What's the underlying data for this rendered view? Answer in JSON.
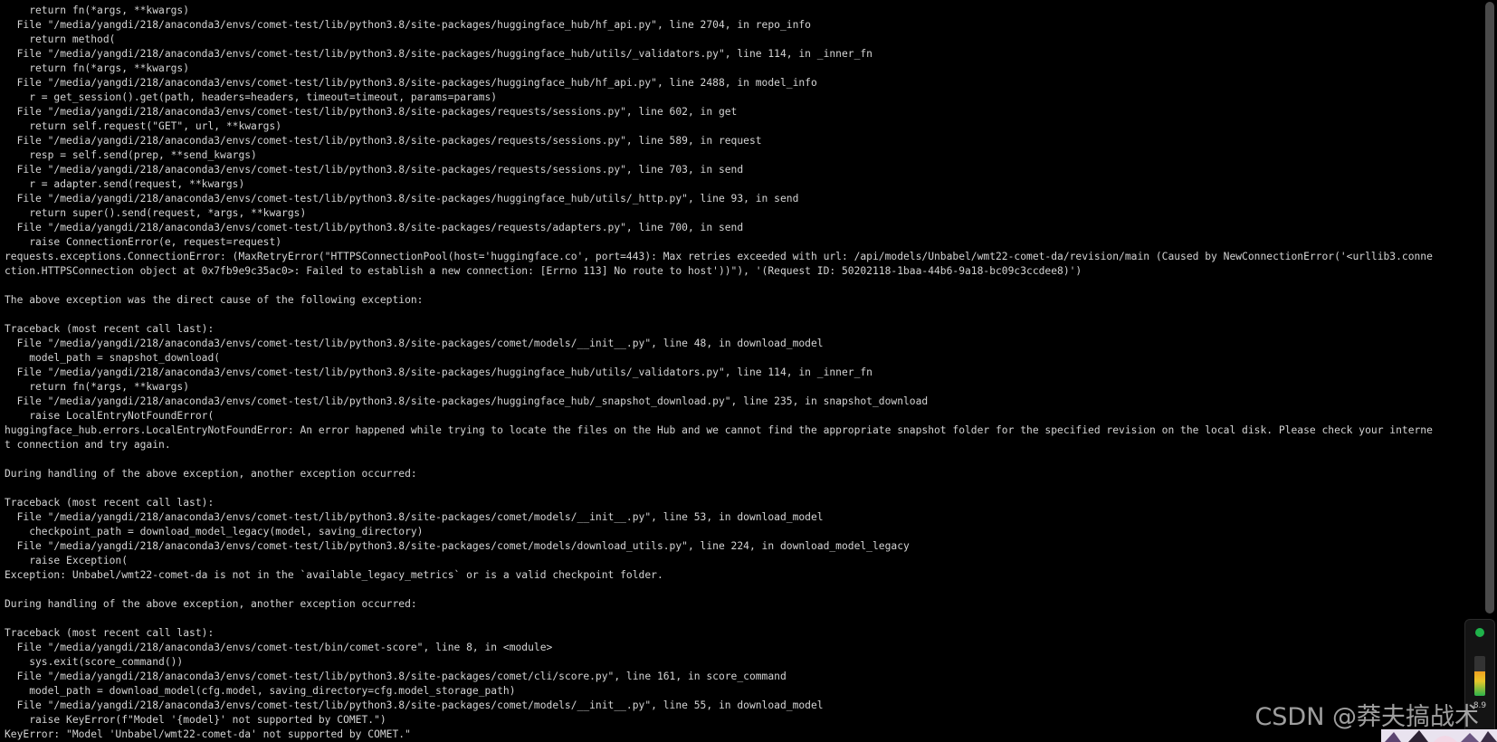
{
  "terminal": {
    "lines": [
      "    return fn(*args, **kwargs)",
      "  File \"/media/yangdi/218/anaconda3/envs/comet-test/lib/python3.8/site-packages/huggingface_hub/hf_api.py\", line 2704, in repo_info",
      "    return method(",
      "  File \"/media/yangdi/218/anaconda3/envs/comet-test/lib/python3.8/site-packages/huggingface_hub/utils/_validators.py\", line 114, in _inner_fn",
      "    return fn(*args, **kwargs)",
      "  File \"/media/yangdi/218/anaconda3/envs/comet-test/lib/python3.8/site-packages/huggingface_hub/hf_api.py\", line 2488, in model_info",
      "    r = get_session().get(path, headers=headers, timeout=timeout, params=params)",
      "  File \"/media/yangdi/218/anaconda3/envs/comet-test/lib/python3.8/site-packages/requests/sessions.py\", line 602, in get",
      "    return self.request(\"GET\", url, **kwargs)",
      "  File \"/media/yangdi/218/anaconda3/envs/comet-test/lib/python3.8/site-packages/requests/sessions.py\", line 589, in request",
      "    resp = self.send(prep, **send_kwargs)",
      "  File \"/media/yangdi/218/anaconda3/envs/comet-test/lib/python3.8/site-packages/requests/sessions.py\", line 703, in send",
      "    r = adapter.send(request, **kwargs)",
      "  File \"/media/yangdi/218/anaconda3/envs/comet-test/lib/python3.8/site-packages/huggingface_hub/utils/_http.py\", line 93, in send",
      "    return super().send(request, *args, **kwargs)",
      "  File \"/media/yangdi/218/anaconda3/envs/comet-test/lib/python3.8/site-packages/requests/adapters.py\", line 700, in send",
      "    raise ConnectionError(e, request=request)",
      "requests.exceptions.ConnectionError: (MaxRetryError(\"HTTPSConnectionPool(host='huggingface.co', port=443): Max retries exceeded with url: /api/models/Unbabel/wmt22-comet-da/revision/main (Caused by NewConnectionError('<urllib3.conne",
      "ction.HTTPSConnection object at 0x7fb9e9c35ac0>: Failed to establish a new connection: [Errno 113] No route to host'))\"), '(Request ID: 50202118-1baa-44b6-9a18-bc09c3ccdee8)')",
      "",
      "The above exception was the direct cause of the following exception:",
      "",
      "Traceback (most recent call last):",
      "  File \"/media/yangdi/218/anaconda3/envs/comet-test/lib/python3.8/site-packages/comet/models/__init__.py\", line 48, in download_model",
      "    model_path = snapshot_download(",
      "  File \"/media/yangdi/218/anaconda3/envs/comet-test/lib/python3.8/site-packages/huggingface_hub/utils/_validators.py\", line 114, in _inner_fn",
      "    return fn(*args, **kwargs)",
      "  File \"/media/yangdi/218/anaconda3/envs/comet-test/lib/python3.8/site-packages/huggingface_hub/_snapshot_download.py\", line 235, in snapshot_download",
      "    raise LocalEntryNotFoundError(",
      "huggingface_hub.errors.LocalEntryNotFoundError: An error happened while trying to locate the files on the Hub and we cannot find the appropriate snapshot folder for the specified revision on the local disk. Please check your interne",
      "t connection and try again.",
      "",
      "During handling of the above exception, another exception occurred:",
      "",
      "Traceback (most recent call last):",
      "  File \"/media/yangdi/218/anaconda3/envs/comet-test/lib/python3.8/site-packages/comet/models/__init__.py\", line 53, in download_model",
      "    checkpoint_path = download_model_legacy(model, saving_directory)",
      "  File \"/media/yangdi/218/anaconda3/envs/comet-test/lib/python3.8/site-packages/comet/models/download_utils.py\", line 224, in download_model_legacy",
      "    raise Exception(",
      "Exception: Unbabel/wmt22-comet-da is not in the `available_legacy_metrics` or is a valid checkpoint folder.",
      "",
      "During handling of the above exception, another exception occurred:",
      "",
      "Traceback (most recent call last):",
      "  File \"/media/yangdi/218/anaconda3/envs/comet-test/bin/comet-score\", line 8, in <module>",
      "    sys.exit(score_command())",
      "  File \"/media/yangdi/218/anaconda3/envs/comet-test/lib/python3.8/site-packages/comet/cli/score.py\", line 161, in score_command",
      "    model_path = download_model(cfg.model, saving_directory=cfg.model_storage_path)",
      "  File \"/media/yangdi/218/anaconda3/envs/comet-test/lib/python3.8/site-packages/comet/models/__init__.py\", line 55, in download_model",
      "    raise KeyError(f\"Model '{model}' not supported by COMET.\")",
      "KeyError: \"Model 'Unbabel/wmt22-comet-da' not supported by COMET.\""
    ],
    "text_color": "#d4d4d4",
    "background_color": "#000000"
  },
  "side_widget": {
    "status_color": "#1fb24a",
    "status_icon": "status-dot-icon",
    "level_icon": "battery-level-icon",
    "level_fraction": 0.62,
    "reading": "8.9"
  },
  "watermark": {
    "text": "CSDN @莽夫搞战术"
  }
}
